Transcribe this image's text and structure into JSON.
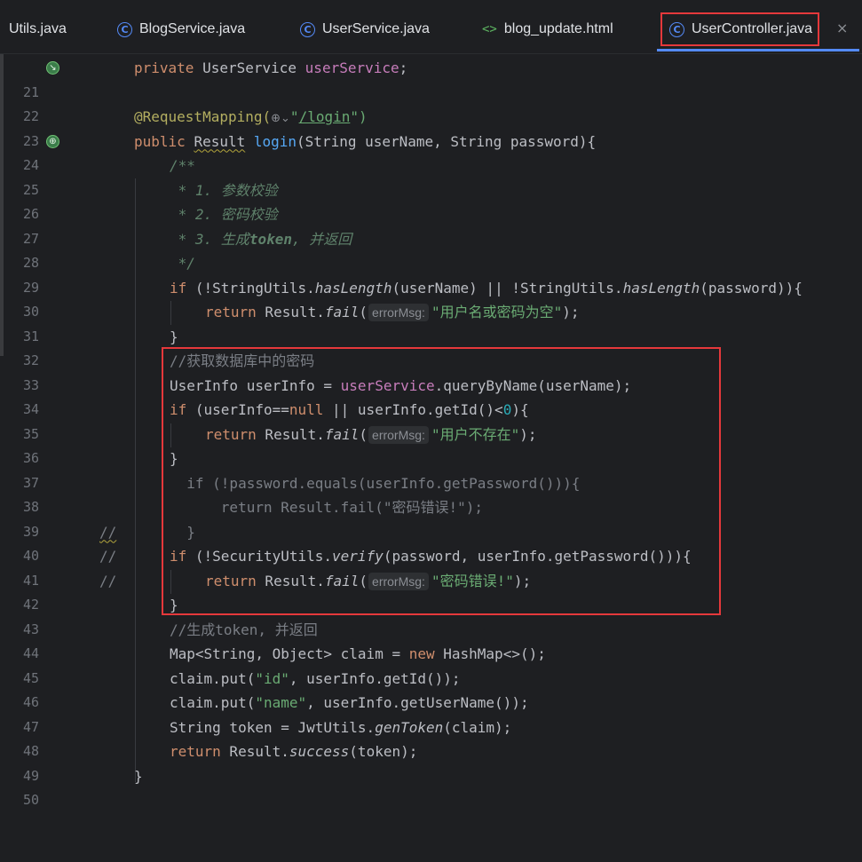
{
  "tabs": [
    {
      "label": "Utils.java",
      "icon": "none"
    },
    {
      "label": "BlogService.java",
      "icon": "class-icon"
    },
    {
      "label": "UserService.java",
      "icon": "class-icon"
    },
    {
      "label": "blog_update.html",
      "icon": "html-icon"
    },
    {
      "label": "UserController.java",
      "icon": "class-icon",
      "active": true
    }
  ],
  "line_numbers": [
    "21",
    "22",
    "23",
    "24",
    "25",
    "26",
    "27",
    "28",
    "29",
    "30",
    "31",
    "32",
    "33",
    "34",
    "35",
    "36",
    "37",
    "38",
    "39",
    "40",
    "41",
    "42",
    "43",
    "44",
    "45",
    "46",
    "47",
    "48",
    "49",
    "50"
  ],
  "code": {
    "l21": {
      "kw": "private",
      "type": " UserService ",
      "field": "userService",
      "end": ";"
    },
    "l23": {
      "ann": "@RequestMapping(",
      "url": "/login",
      "end": "\")",
      "q": "\""
    },
    "l24": {
      "kw": "public ",
      "type": "Result",
      "fn": " login",
      "rest": "(String userName, String password){"
    },
    "l25": "/**",
    "l26": " * 1. 参数校验",
    "l27": " * 2. 密码校验",
    "l28a": " * 3. 生成",
    "l28b": "token",
    "l28c": ", 并返回",
    "l29": " */",
    "l30": {
      "kw": "if",
      "a": " (!StringUtils.",
      "m1": "hasLength",
      "b": "(userName) || !StringUtils.",
      "m2": "hasLength",
      "c": "(password)){"
    },
    "l31": {
      "kw": "return",
      "a": " Result.",
      "m": "fail",
      "b": "(",
      "hint": "errorMsg:",
      "str": "\"用户名或密码为空\"",
      "c": ");"
    },
    "l32": "}",
    "l33": "//获取数据库中的密码",
    "l34": {
      "a": "UserInfo userInfo = ",
      "field": "userService",
      "b": ".queryByName(userName);"
    },
    "l35": {
      "kw": "if",
      "a": " (userInfo==",
      "kw2": "null",
      "b": " || userInfo.getId()<",
      "num": "0",
      "c": "){"
    },
    "l36": {
      "kw": "return",
      "a": " Result.",
      "m": "fail",
      "b": "(",
      "hint": "errorMsg:",
      "str": "\"用户不存在\"",
      "c": ");"
    },
    "l37": "}",
    "l38_prefix": "//",
    "l38": "  if (!password.equals(userInfo.getPassword())){",
    "l39_prefix": "//",
    "l39": "      return Result.fail(\"密码错误!\");",
    "l40_prefix": "//",
    "l40": "  }",
    "l41": {
      "kw": "if",
      "a": " (!SecurityUtils.",
      "m": "verify",
      "b": "(password, userInfo.getPassword())){"
    },
    "l42": {
      "kw": "return",
      "a": " Result.",
      "m": "fail",
      "b": "(",
      "hint": "errorMsg:",
      "str": "\"密码错误!\"",
      "c": ");"
    },
    "l43": "}",
    "l44": "//生成token, 并返回",
    "l45": {
      "a": "Map<String, Object> claim = ",
      "kw": "new",
      "b": " HashMap<>();"
    },
    "l46": {
      "a": "claim.put(",
      "str": "\"id\"",
      "b": ", userInfo.getId());"
    },
    "l47": {
      "a": "claim.put(",
      "str": "\"name\"",
      "b": ", userInfo.getUserName());"
    },
    "l48": {
      "a": "String token = JwtUtils.",
      "m": "genToken",
      "b": "(claim);"
    },
    "l49": {
      "kw": "return",
      "a": " Result.",
      "m": "success",
      "b": "(token);"
    },
    "l50": "}"
  },
  "close_symbol": "×",
  "colors": {
    "highlight_box": "#e5383b",
    "active_tab_underline": "#548af7"
  }
}
